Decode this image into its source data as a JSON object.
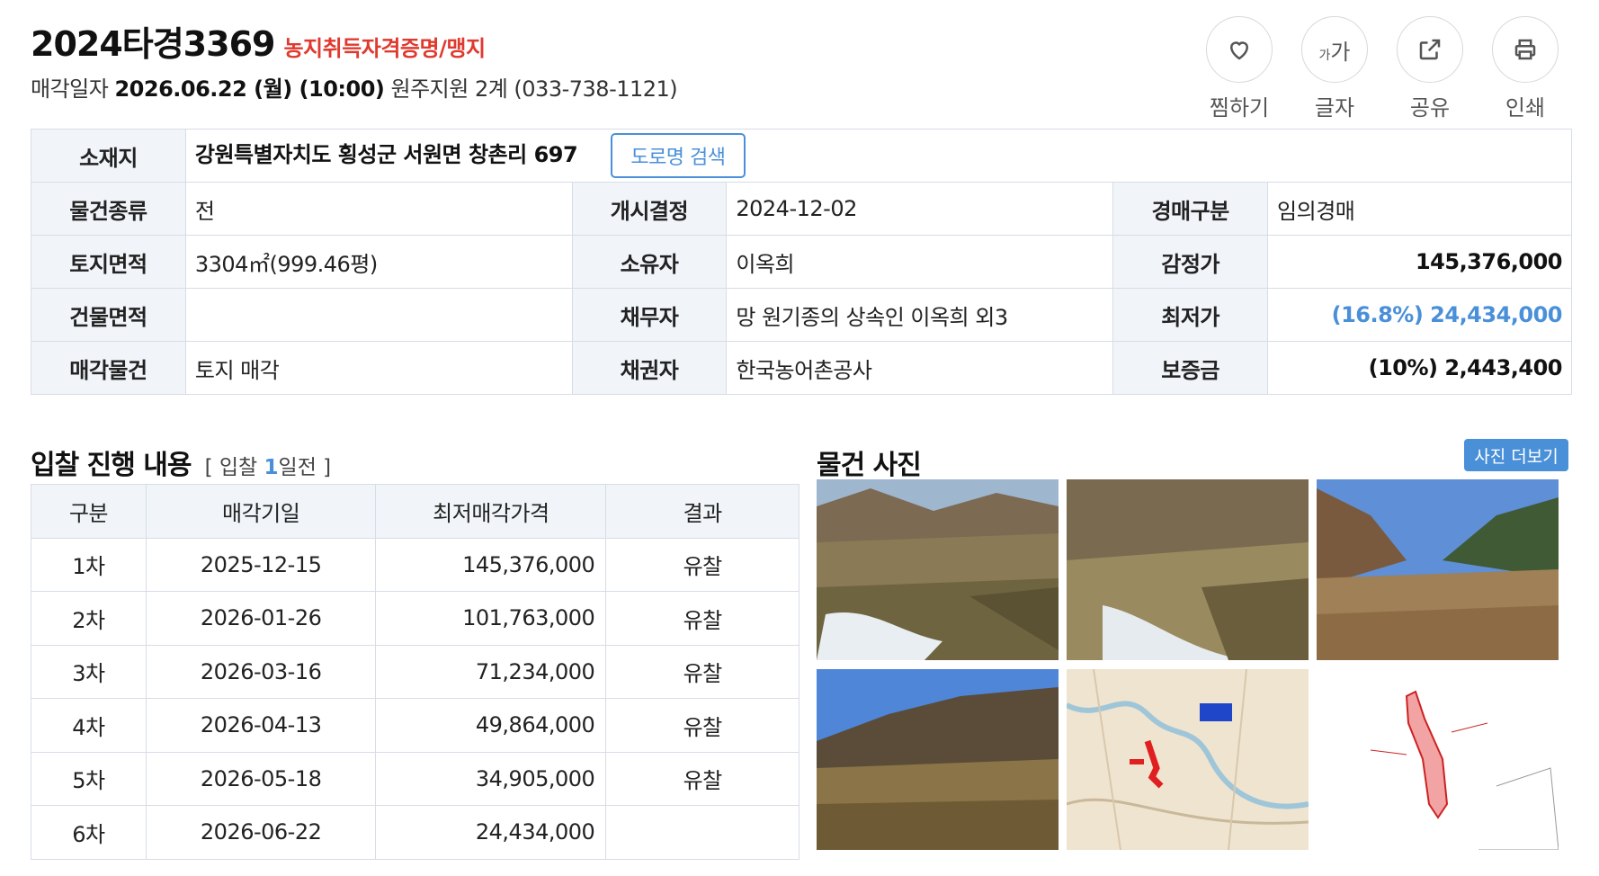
{
  "header": {
    "case_no": "2024타경3369",
    "tag": "농지취득자격증명/맹지",
    "sale_prefix": "매각일자",
    "sale_datetime": "2026.06.22 (월) (10:00)",
    "court": "원주지원 2계 (033-738-1121)"
  },
  "actions": [
    {
      "label": "찜하기",
      "icon": "heart-icon"
    },
    {
      "label": "글자",
      "icon": "font-size-icon",
      "glyph_small": "가",
      "glyph_big": "가"
    },
    {
      "label": "공유",
      "icon": "share-icon"
    },
    {
      "label": "인쇄",
      "icon": "print-icon"
    }
  ],
  "info": {
    "location_label": "소재지",
    "location_value": "강원특별자치도 횡성군 서원면 창촌리 697",
    "road_search_label": "도로명 검색",
    "rows": [
      {
        "l1": "물건종류",
        "v1": "전",
        "l2": "개시결정",
        "v2": "2024-12-02",
        "l3": "경매구분",
        "v3": "임의경매"
      },
      {
        "l1": "토지면적",
        "v1": "3304㎡(999.46평)",
        "l2": "소유자",
        "v2": "이옥희",
        "l3": "감정가",
        "v3": "145,376,000"
      },
      {
        "l1": "건물면적",
        "v1": "",
        "l2": "채무자",
        "v2": "망 원기종의 상속인 이옥희 외3",
        "l3": "최저가",
        "v3": "(16.8%) 24,434,000"
      },
      {
        "l1": "매각물건",
        "v1": "토지 매각",
        "l2": "채권자",
        "v2": "한국농어촌공사",
        "l3": "보증금",
        "v3": "(10%) 2,443,400"
      }
    ]
  },
  "bid": {
    "title": "입찰 진행 내용",
    "sub_open": "[ 입찰 ",
    "sub_num": "1",
    "sub_close": "일전 ]",
    "columns": [
      "구분",
      "매각기일",
      "최저매각가격",
      "결과"
    ],
    "rows": [
      [
        "1차",
        "2025-12-15",
        "145,376,000",
        "유찰"
      ],
      [
        "2차",
        "2026-01-26",
        "101,763,000",
        "유찰"
      ],
      [
        "3차",
        "2026-03-16",
        "71,234,000",
        "유찰"
      ],
      [
        "4차",
        "2026-04-13",
        "49,864,000",
        "유찰"
      ],
      [
        "5차",
        "2026-05-18",
        "34,905,000",
        "유찰"
      ],
      [
        "6차",
        "2026-06-22",
        "24,434,000",
        ""
      ]
    ]
  },
  "photos": {
    "title": "물건 사진",
    "more_label": "사진 더보기",
    "items": [
      "field-photo",
      "field-photo",
      "field-photo",
      "field-photo",
      "location-map",
      "parcel-diagram"
    ]
  },
  "colors": {
    "accent": "#4a90d9",
    "tag_red": "#e03a2f",
    "header_cell_bg": "#f1f5f9",
    "border": "#d6dde6"
  }
}
